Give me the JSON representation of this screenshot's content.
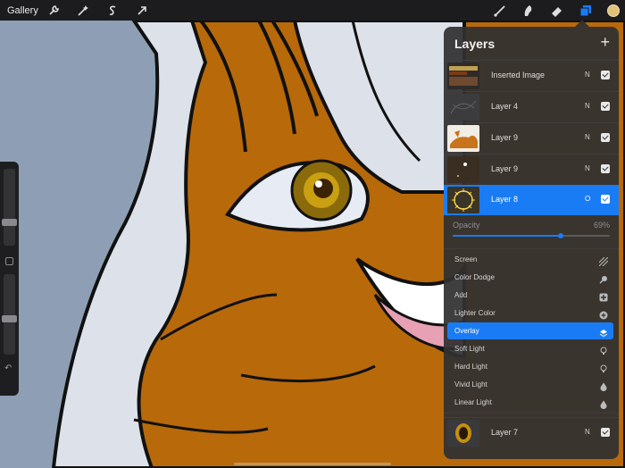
{
  "toolbar": {
    "gallery_label": "Gallery",
    "left_icons": [
      "wrench-icon",
      "magic-wand-icon",
      "selection-icon",
      "transform-arrow-icon"
    ],
    "right_icons": [
      "brush-icon",
      "smudge-icon",
      "eraser-icon",
      "layers-icon"
    ],
    "active_color": "#e0c27a",
    "accent": "#1a7cf5"
  },
  "sidebar": {
    "size_slider_level": 0.3,
    "opacity_slider_level": 0.45
  },
  "layers_panel": {
    "title": "Layers",
    "add_label": "+",
    "layers": [
      {
        "name": "Inserted Image",
        "mode": "N",
        "visible": true,
        "selected": false
      },
      {
        "name": "Layer 4",
        "mode": "N",
        "visible": true,
        "selected": false
      },
      {
        "name": "Layer 9",
        "mode": "N",
        "visible": true,
        "selected": false
      },
      {
        "name": "Layer 9",
        "mode": "N",
        "visible": true,
        "selected": false
      },
      {
        "name": "Layer 8",
        "mode": "O",
        "visible": true,
        "selected": true
      }
    ],
    "opacity": {
      "label": "Opacity",
      "value_text": "69%",
      "value": 0.69
    },
    "blend_modes": [
      {
        "label": "Screen",
        "icon": "hatch-icon",
        "selected": false
      },
      {
        "label": "Color Dodge",
        "icon": "dropper-icon",
        "selected": false
      },
      {
        "label": "Add",
        "icon": "plus-square-icon",
        "selected": false
      },
      {
        "label": "Lighter Color",
        "icon": "plus-circle-icon",
        "selected": false
      },
      {
        "label": "Overlay",
        "icon": "layers-icon",
        "selected": true
      },
      {
        "label": "Soft Light",
        "icon": "bulb-icon",
        "selected": false
      },
      {
        "label": "Hard Light",
        "icon": "bulb-icon",
        "selected": false
      },
      {
        "label": "Vivid Light",
        "icon": "drop-icon",
        "selected": false
      },
      {
        "label": "Linear Light",
        "icon": "drop-icon",
        "selected": false
      }
    ],
    "bottom_layer": {
      "name": "Layer 7",
      "mode": "N",
      "visible": true
    }
  }
}
